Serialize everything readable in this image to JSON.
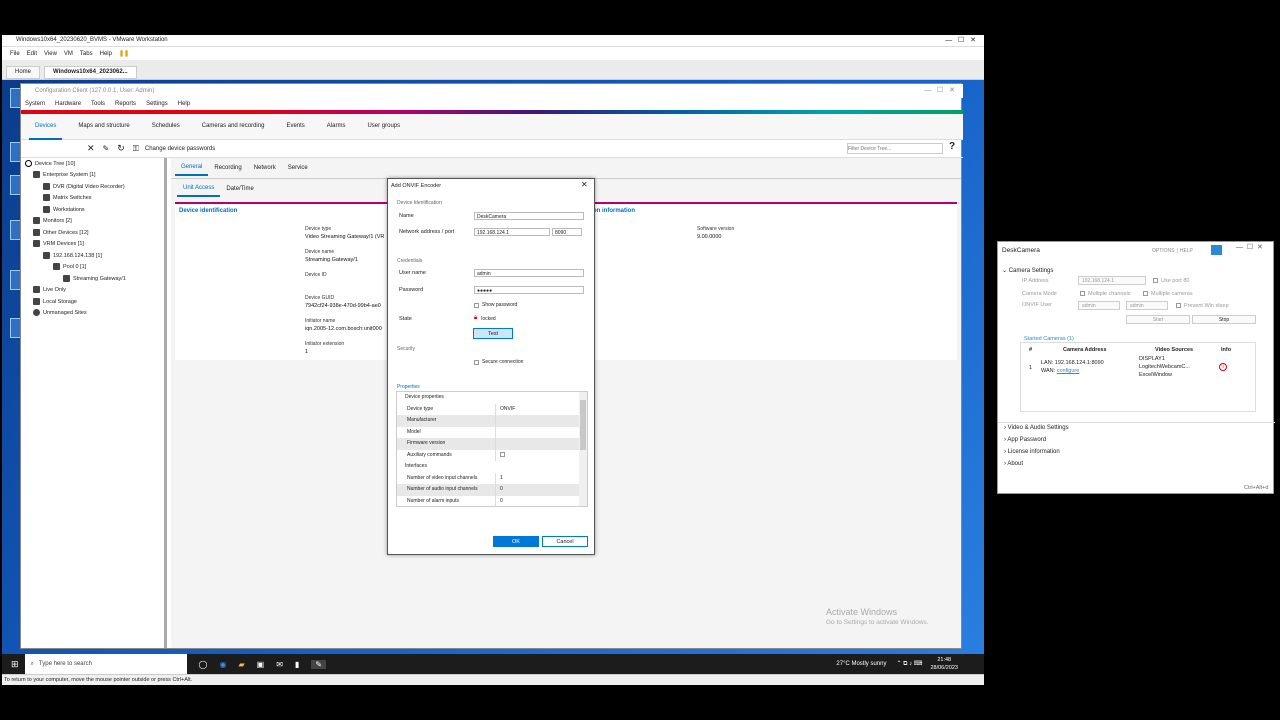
{
  "vm": {
    "title": "Windows10x64_20230620_BVMS - VMware Workstation",
    "menu": [
      "File",
      "Edit",
      "View",
      "VM",
      "Tabs",
      "Help"
    ],
    "tabs": [
      "Home",
      "Windows10x64_2023062..."
    ],
    "status": "To return to your computer, move the mouse pointer outside or press Ctrl+Alt."
  },
  "cc": {
    "title": "Configuration Client (127.0.0.1, User: Admin)",
    "menu": [
      "System",
      "Hardware",
      "Tools",
      "Reports",
      "Settings",
      "Help"
    ],
    "nav": [
      "Devices",
      "Maps and structure",
      "Schedules",
      "Cameras and recording",
      "Events",
      "Alarms",
      "User groups"
    ],
    "change_pw": "Change device passwords",
    "filter_placeholder": "Filter Device Tree...",
    "tree": [
      "Device Tree [10]",
      "Enterprise System [1]",
      "DVR (Digital Video Recorder)",
      "Matrix Switches",
      "Workstations",
      "Monitors [2]",
      "Other Devices [12]",
      "VRM Devices [1]",
      "192.168.124.138 [1]",
      "Pool 0 [1]",
      "Streaming Gateway/1",
      "Live Only",
      "Local Storage",
      "Unmanaged Sites"
    ],
    "tabs": [
      "General",
      "Recording",
      "Network",
      "Service"
    ],
    "subtabs": [
      "Unit Access",
      "Date/Time"
    ],
    "section_ident": "Device identification",
    "section_info": "on information",
    "device_type_label": "Device type",
    "device_type_value": "Video Streaming Gateway/1 (VR",
    "device_name_label": "Device name",
    "device_name_value": "Streaming Gateway/1",
    "device_id_label": "Device ID",
    "device_guid_label": "Device GUID",
    "device_guid_value": "7942cf24-938e-470d-99b4-ae0",
    "initiator_label": "Initiator name",
    "initiator_value": "iqn.2005-12.com.bosch:unit000",
    "initiator_ext_label": "Initiator extension",
    "initiator_ext_value": "1",
    "software_label": "Software version",
    "software_value": "9.00.0000",
    "watermark1": "Activate Windows",
    "watermark2": "Go to Settings to activate Windows."
  },
  "dialog": {
    "title": "Add ONVIF Encoder",
    "s_ident": "Device Identification",
    "name_label": "Name",
    "name_value": "DeskCamera",
    "addr_label": "Network address / port",
    "addr_value": "192.168.124.1",
    "port_value": "8090",
    "s_cred": "Credentials",
    "user_label": "User name",
    "user_value": "admin",
    "pw_label": "Password",
    "pw_value": "●●●●●",
    "show_pw": "Show password",
    "state_label": "State",
    "state_value": "locked",
    "test": "Test",
    "s_security": "Security",
    "secure": "Secure connection",
    "s_props": "Properties",
    "props": [
      {
        "k": "Device properties",
        "v": "",
        "cat": true
      },
      {
        "k": "Device type",
        "v": "ONVIF"
      },
      {
        "k": "Manufacturer",
        "v": ""
      },
      {
        "k": "Model",
        "v": ""
      },
      {
        "k": "Firmware version",
        "v": ""
      },
      {
        "k": "Auxiliary commands",
        "v": ""
      },
      {
        "k": "Interfaces",
        "v": "",
        "cat": true
      },
      {
        "k": "Number of video input channels",
        "v": "1"
      },
      {
        "k": "Number of audio input channels",
        "v": "0"
      },
      {
        "k": "Number of alarm inputs",
        "v": "0"
      }
    ],
    "ok": "OK",
    "cancel": "Cancel"
  },
  "deskcam": {
    "title": "DeskCamera",
    "options": "OPTIONS",
    "help": "HELP",
    "camera_settings": "Camera Settings",
    "ip_label": "IP Address",
    "ip_value": "192.168.124.1",
    "use_port": "Use port 80",
    "mode_label": "Camera Mode",
    "multi_channels": "Multiple channels",
    "multi_cameras": "Multiple cameras",
    "onvif_label": "ONVIF User",
    "onvif_user": "admin",
    "onvif_pw": "admin",
    "prevent": "Prevent Win sleep",
    "start": "Start",
    "stop": "Stop",
    "started": "Started Cameras (1)",
    "col_num": "#",
    "col_addr": "Camera Address",
    "col_src": "Video Sources",
    "col_info": "Info",
    "row_num": "1",
    "lan": "LAN:  192.168.124.1:8090",
    "wan_label": "WAN:",
    "wan_link": "configure",
    "sources": [
      "DISPLAY1",
      "LogitechWebcamC...",
      "ExcelWindow"
    ],
    "links": [
      "Video & Audio Settings",
      "App Password",
      "License information",
      "About"
    ],
    "shortcut": "Ctrl+Alt+d"
  },
  "taskbar": {
    "search": "Type here to search",
    "weather": "27°C  Mostly sunny",
    "time": "21:48",
    "date": "28/06/2023"
  }
}
